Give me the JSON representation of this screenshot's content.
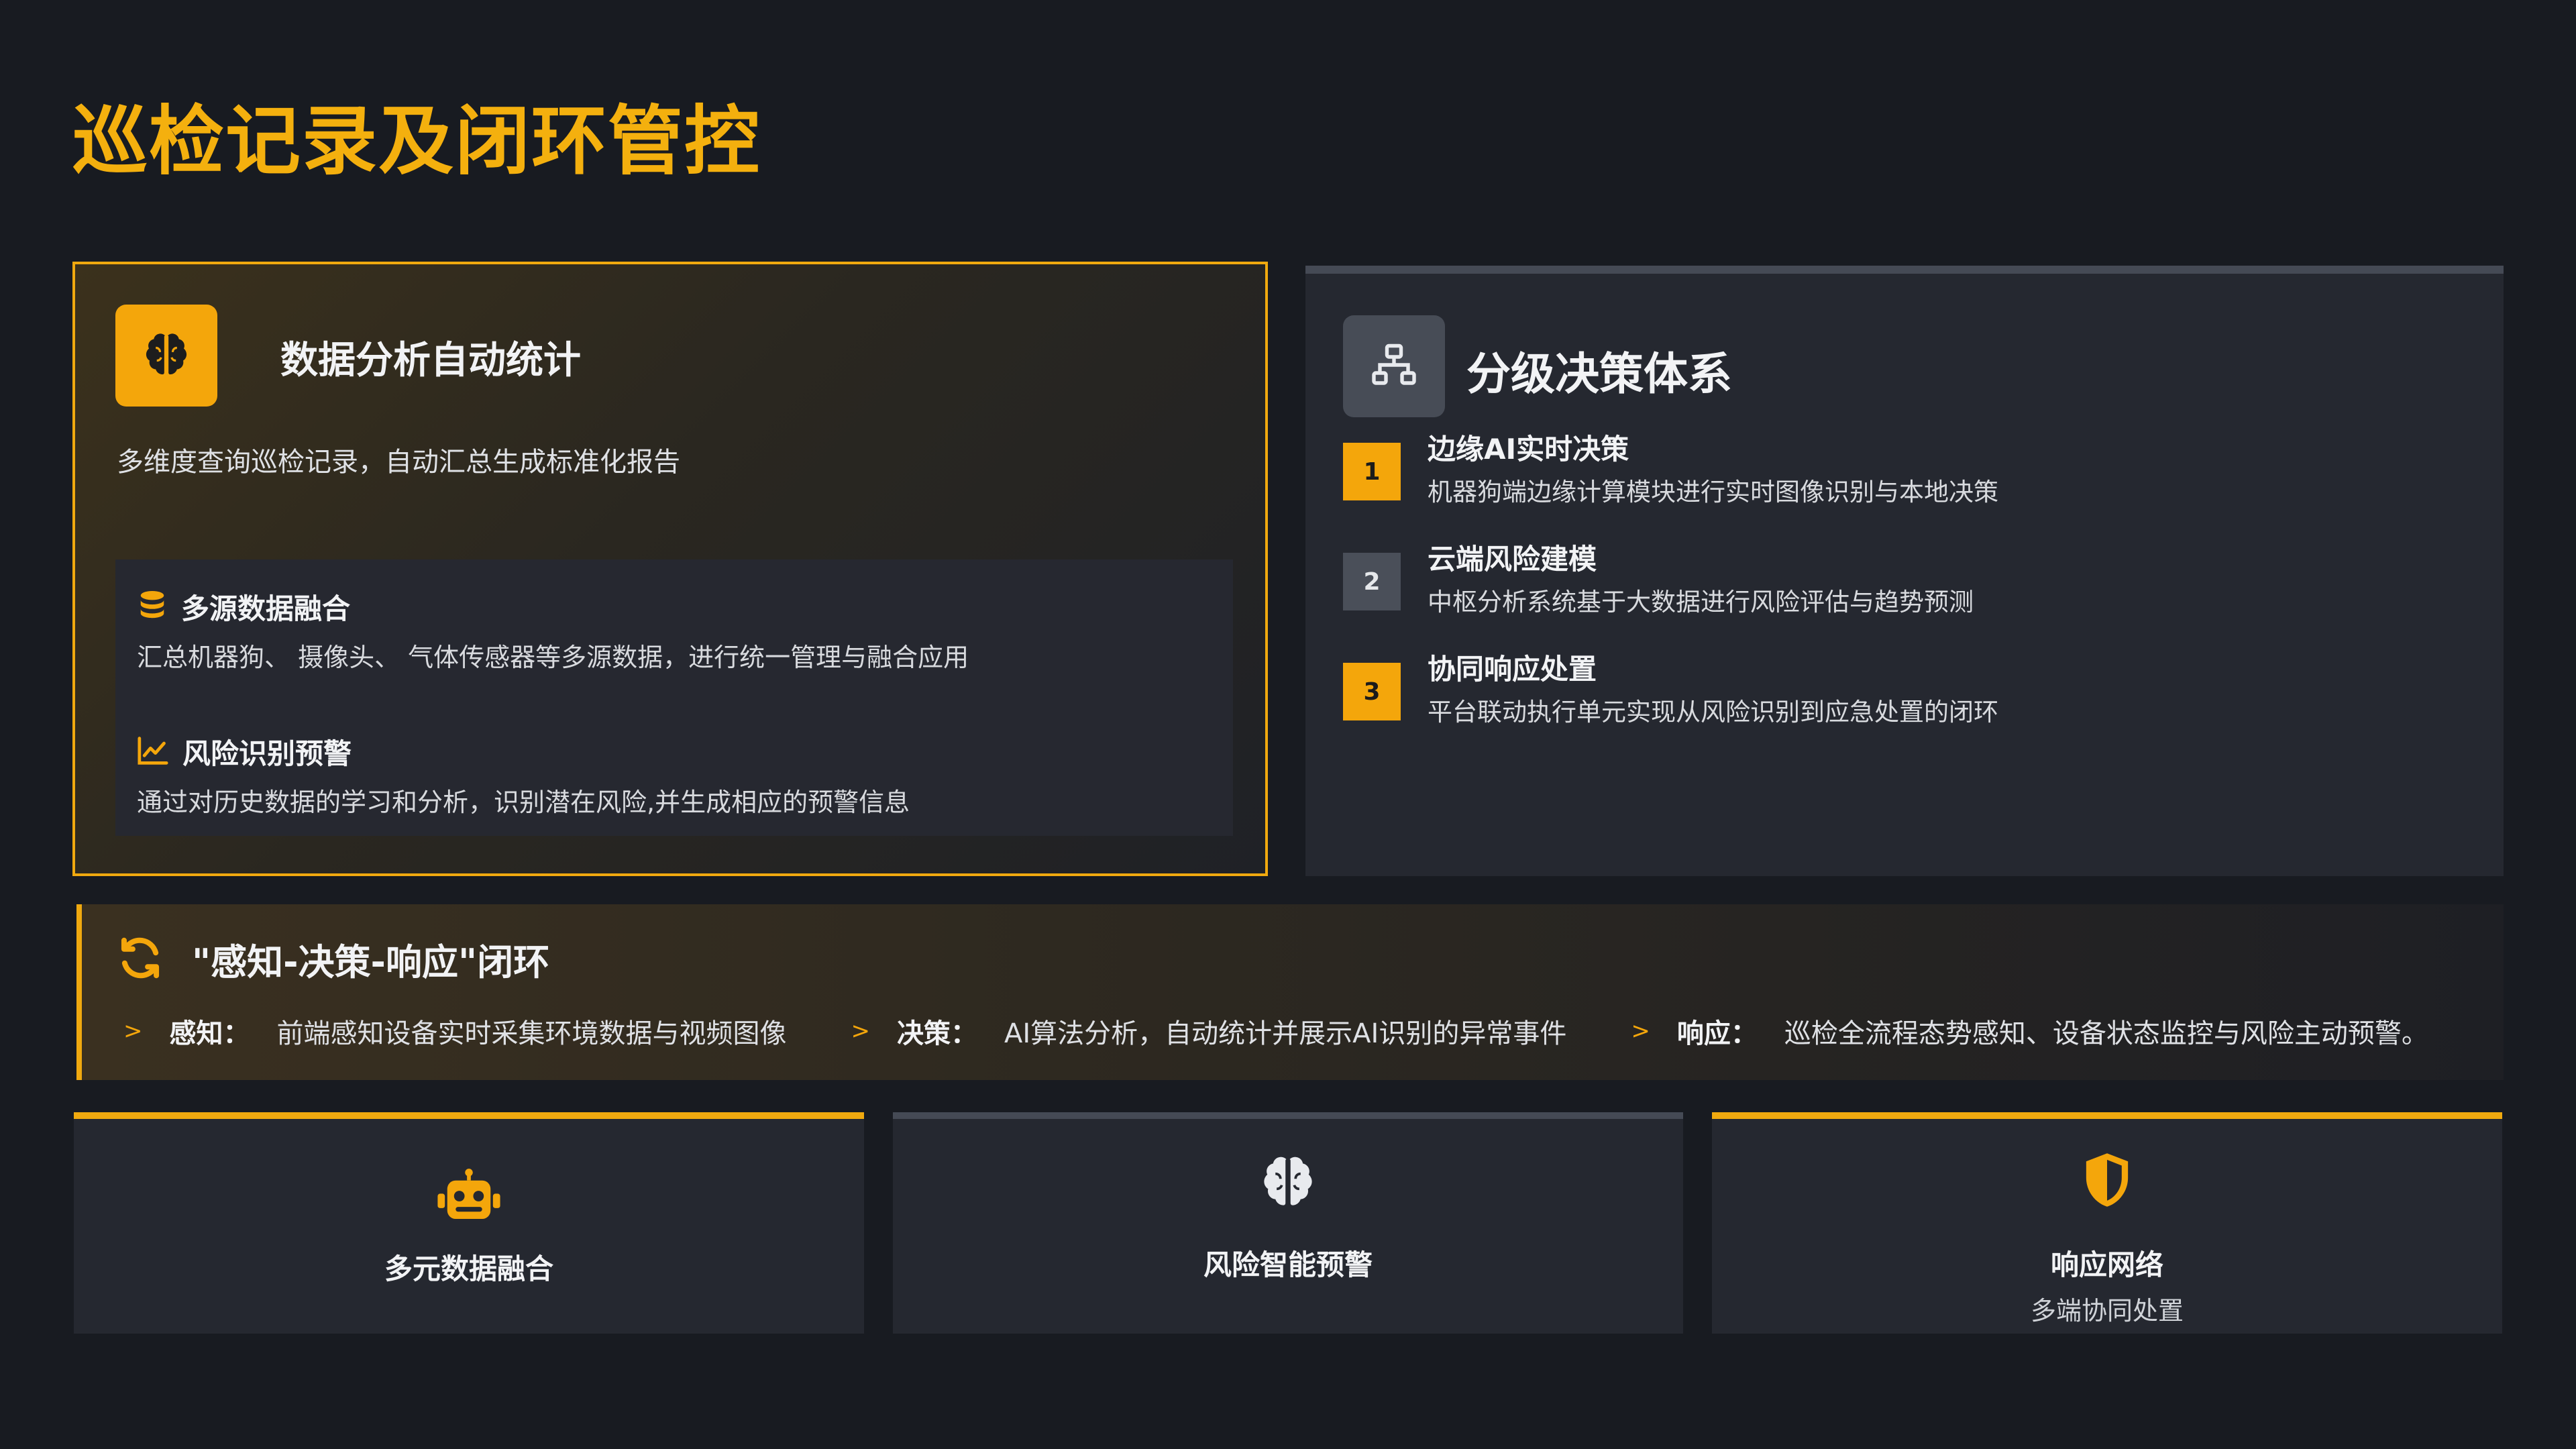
{
  "page": {
    "title": "巡检记录及闭环管控"
  },
  "colors": {
    "accent": "#f4a60b",
    "background": "#181b21",
    "card": "#252830",
    "muted": "#474c56"
  },
  "analysis_card": {
    "icon": "brain-icon",
    "title": "数据分析自动统计",
    "description": "多维度查询巡检记录，自动汇总生成标准化报告",
    "features": [
      {
        "icon": "database-icon",
        "title": "多源数据融合",
        "description": "汇总机器狗、 摄像头、 气体传感器等多源数据，进行统一管理与融合应用"
      },
      {
        "icon": "line-chart-icon",
        "title": "风险识别预警",
        "description": "通过对历史数据的学习和分析，识别潜在风险,并生成相应的预警信息"
      }
    ]
  },
  "decision_card": {
    "icon": "network-icon",
    "title": "分级决策体系",
    "steps": [
      {
        "number": "1",
        "title": "边缘AI实时决策",
        "description": "机器狗端边缘计算模块进行实时图像识别与本地决策"
      },
      {
        "number": "2",
        "title": "云端风险建模",
        "description": "中枢分析系统基于大数据进行风险评估与趋势预测"
      },
      {
        "number": "3",
        "title": "协同响应处置",
        "description": "平台联动执行单元实现从风险识别到应急处置的闭环"
      }
    ]
  },
  "loop_banner": {
    "icon": "sync-icon",
    "title": "\"感知-决策-响应\"闭环",
    "marker": ">",
    "items": [
      {
        "label": "感知：",
        "text": "前端感知设备实时采集环境数据与视频图像"
      },
      {
        "label": "决策：",
        "text": "AI算法分析，自动统计并展示AI识别的异常事件"
      },
      {
        "label": "响应：",
        "text": "巡检全流程态势感知、设备状态监控与风险主动预警。"
      }
    ]
  },
  "bottom_cards": [
    {
      "icon": "robot-icon",
      "label": "多元数据融合",
      "sublabel": ""
    },
    {
      "icon": "brain-icon",
      "label": "风险智能预警",
      "sublabel": ""
    },
    {
      "icon": "shield-icon",
      "label": "响应网络",
      "sublabel": "多端协同处置"
    }
  ]
}
